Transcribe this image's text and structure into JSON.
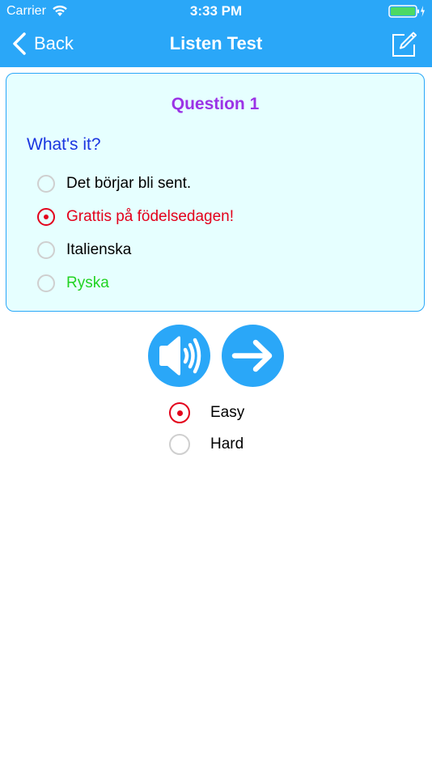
{
  "status_bar": {
    "carrier": "Carrier",
    "time": "3:33 PM"
  },
  "nav": {
    "back_label": "Back",
    "title": "Listen Test",
    "edit_icon": "edit-note-icon"
  },
  "question": {
    "title": "Question 1",
    "prompt": "What's it?",
    "options": [
      {
        "label": "Det börjar bli sent.",
        "selected": false,
        "color": "#000000"
      },
      {
        "label": "Grattis på födelsedagen!",
        "selected": true,
        "color": "#e3001b"
      },
      {
        "label": "Italienska",
        "selected": false,
        "color": "#000000"
      },
      {
        "label": "Ryska",
        "selected": false,
        "color": "#22d322"
      }
    ]
  },
  "actions": {
    "speaker_icon": "speaker-icon",
    "next_icon": "arrow-right-icon"
  },
  "difficulty": {
    "options": [
      {
        "label": "Easy",
        "selected": true
      },
      {
        "label": "Hard",
        "selected": false
      }
    ]
  },
  "colors": {
    "accent": "#2aa7f8",
    "card_background": "#e6ffff",
    "question_title": "#9b33e6",
    "prompt": "#1a35e0",
    "selected_radio": "#e3001b",
    "correct_answer": "#22d322",
    "battery_fill": "#4cd964"
  }
}
